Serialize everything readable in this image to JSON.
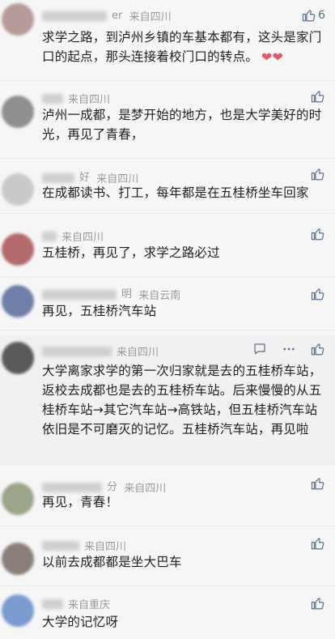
{
  "comments": [
    {
      "nick_visible": "er",
      "location": "来自四川",
      "text": "求学之路，到泸州乡镇的车基本都有，这头是家门口的起点，那头连接着校门口的转点。",
      "emoji": "❤❤",
      "likes": "6",
      "avatar_color": "#b79a9a"
    },
    {
      "nick_visible": "",
      "location": "来自四川",
      "text": "泸州一成都，是梦开始的地方，也是大学美好的时光，再见了青春，",
      "likes": "",
      "avatar_color": "#8f8f8f"
    },
    {
      "nick_visible": "好",
      "location": "来自四川",
      "text": "在成都读书、打工，每年都是在五桂桥坐车回家",
      "likes": "",
      "avatar_color": "#c9c9c9"
    },
    {
      "nick_visible": "",
      "location": "来自四川",
      "text": "五桂桥，再见了，求学之路必过",
      "likes": "",
      "avatar_color": "#b36a6a"
    },
    {
      "nick_visible": "明",
      "location": "来自云南",
      "text": "再见，五桂桥汽车站",
      "likes": "",
      "avatar_color": "#6f7fa8"
    },
    {
      "nick_visible": "",
      "location": "来自四川",
      "text": "大学离家求学的第一次归家就是去的五桂桥车站，返校去成都也是去的五桂桥车站。后来慢慢的从五桂桥车站→其它汽车站→高铁站，但五桂桥汽车站依旧是不可磨灭的记忆。五桂桥汽车站，再见啦",
      "likes": "",
      "avatar_color": "#5a5a5a"
    },
    {
      "nick_visible": "分",
      "location": "来自四川",
      "text": "再见，青春！",
      "likes": "",
      "avatar_color": "#9aa58a"
    },
    {
      "nick_visible": "",
      "location": "来自四川",
      "text": "以前去成都都是坐大巴车",
      "likes": "",
      "avatar_color": "#8a7f7a"
    },
    {
      "nick_visible": "",
      "location": "来自重庆",
      "text": "大学的记忆呀",
      "likes": "",
      "avatar_color": "#7a9ad0"
    }
  ],
  "icons": {
    "like": "thumb-up-icon",
    "reply": "comment-bubble-icon",
    "more": "more-dots-icon"
  },
  "colors": {
    "icon": "#5b6f8e",
    "meta": "#9a9a9a",
    "heart": "#e9546b"
  }
}
